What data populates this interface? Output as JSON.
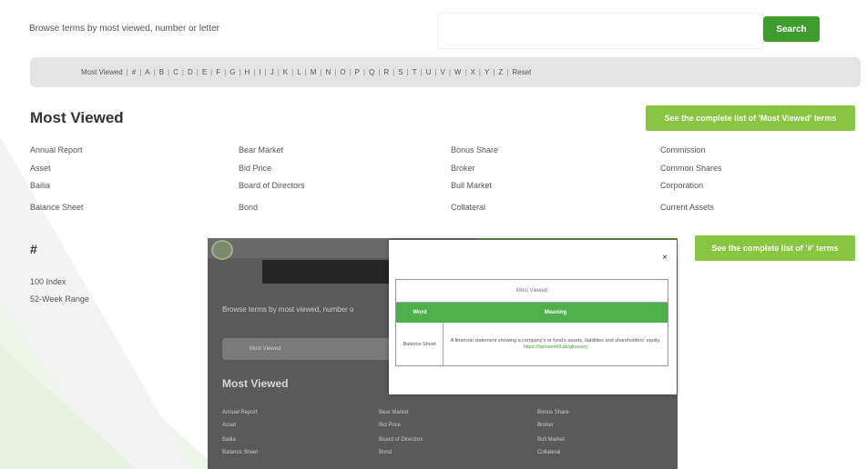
{
  "search": {
    "label": "Browse terms by most viewed, number or letter",
    "input_value": "",
    "button_label": "Search"
  },
  "letter_bar": {
    "items": [
      "Most Viewed",
      "#",
      "A",
      "B",
      "C",
      "D",
      "E",
      "F",
      "G",
      "H",
      "I",
      "J",
      "K",
      "L",
      "M",
      "N",
      "O",
      "P",
      "Q",
      "R",
      "S",
      "T",
      "U",
      "V",
      "W",
      "X",
      "Y",
      "Z"
    ],
    "reset_label": "Reset"
  },
  "most_viewed": {
    "title": "Most Viewed",
    "button_label": "See the complete list of 'Most Viewed' terms",
    "columns": [
      [
        "Annual Report",
        "Asset",
        "Bailia",
        "Balance Sheet"
      ],
      [
        "Bear Market",
        "Bid Price",
        "Board of Directors",
        "Bond"
      ],
      [
        "Bonus Share",
        "Broker",
        "Bull Market",
        "Collateral"
      ],
      [
        "Commission",
        "Common Shares",
        "Corporation",
        "Current Assets"
      ]
    ]
  },
  "hash_section": {
    "title": "#",
    "button_label": "See the complete list of '#' terms",
    "terms": [
      "100 Index",
      "52-Week Range"
    ]
  },
  "inner_screenshot": {
    "search_label": "Browse terms by most viewed, number o",
    "bar_label": "Most Viewed",
    "title": "Most Viewed",
    "col1": [
      "Annual Report",
      "Asset",
      "Bailia",
      "Balance Sheet"
    ],
    "col2": [
      "Bear Market",
      "Bid Price",
      "Board of Directors",
      "Bond"
    ],
    "col3": [
      "Bonus Share",
      "Broker",
      "Bull Market",
      "Collateral"
    ]
  },
  "modal": {
    "close_label": "×",
    "caption": "Most Viewed",
    "head_word": "Word",
    "head_meaning": "Meaning",
    "row_word": "Balance Sheet",
    "row_meaning": "A financial statement showing a company's or fund's assets, liabilities and shareholders' equity.",
    "row_link": "https://tamsonhill.pk/glossary"
  },
  "colors": {
    "search_button": "#3f9d2f",
    "list_button": "#88c540",
    "table_header": "#4db04a"
  }
}
